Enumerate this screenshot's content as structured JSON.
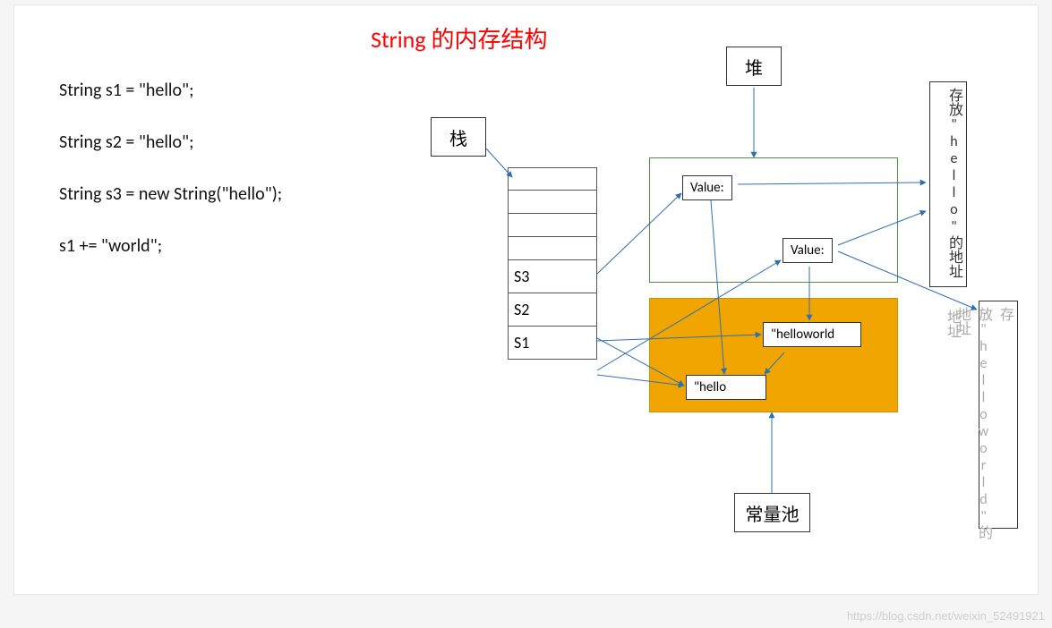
{
  "title": "String 的内存结构",
  "code": {
    "l1": "String s1 = \"hello\";",
    "l2": "String s2 = \"hello\";",
    "l3": "String s3 = new String(\"hello\");",
    "l4": "s1 += \"world\";"
  },
  "labels": {
    "stack": "栈",
    "heap": "堆",
    "pool": "常量池"
  },
  "stack": {
    "r1": "",
    "r2": "",
    "r3": "",
    "r4": "",
    "r5": "S3",
    "r6": "S2",
    "r7": "S1"
  },
  "objects": {
    "value1": "Value:",
    "value2": "Value:",
    "hello": "\"hello",
    "helloworld": "\"helloworld"
  },
  "addresses": {
    "a1": "存放\"hello\"的地址",
    "a2": "存放\"helloworld\"的地址",
    "a2b": "地址"
  },
  "watermark": "https://blog.csdn.net/weixin_52491921"
}
